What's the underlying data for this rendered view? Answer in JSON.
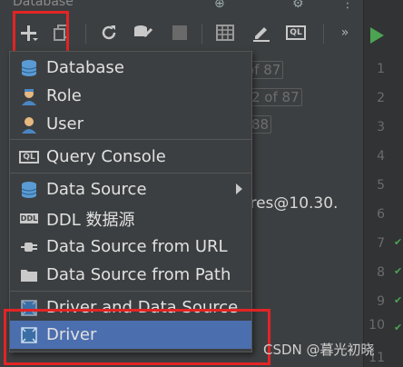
{
  "window": {
    "title": "Database"
  },
  "editor": {
    "line_numbers": [
      "1",
      "2",
      "3",
      "4",
      "5",
      "6",
      "7",
      "8",
      "9",
      "10",
      "11"
    ]
  },
  "background": {
    "count_texts": [
      "of 87",
      "2 of 87",
      "88"
    ],
    "connection_text": "tgres@10.30."
  },
  "menu": {
    "items": [
      {
        "label": "Database",
        "icon": "database-icon"
      },
      {
        "label": "Role",
        "icon": "role-icon"
      },
      {
        "label": "User",
        "icon": "user-icon"
      },
      {
        "label": "Query Console",
        "icon": "query-console-icon",
        "badge": "QL"
      },
      {
        "label": "Data Source",
        "icon": "data-source-icon",
        "submenu": true
      },
      {
        "label": "DDL 数据源",
        "icon": "ddl-icon",
        "badge": "DDL"
      },
      {
        "label": "Data Source from URL",
        "icon": "plug-icon"
      },
      {
        "label": "Data Source from Path",
        "icon": "folder-icon"
      },
      {
        "label": "Driver and Data Source",
        "icon": "driver-icon"
      },
      {
        "label": "Driver",
        "icon": "driver-icon",
        "selected": true
      }
    ]
  },
  "colors": {
    "menu_bg": "#3c3f41",
    "selection": "#4b6eaf",
    "annotation_red": "#e32424",
    "run_green": "#4ca352"
  },
  "watermark": "CSDN @暮光初晓"
}
